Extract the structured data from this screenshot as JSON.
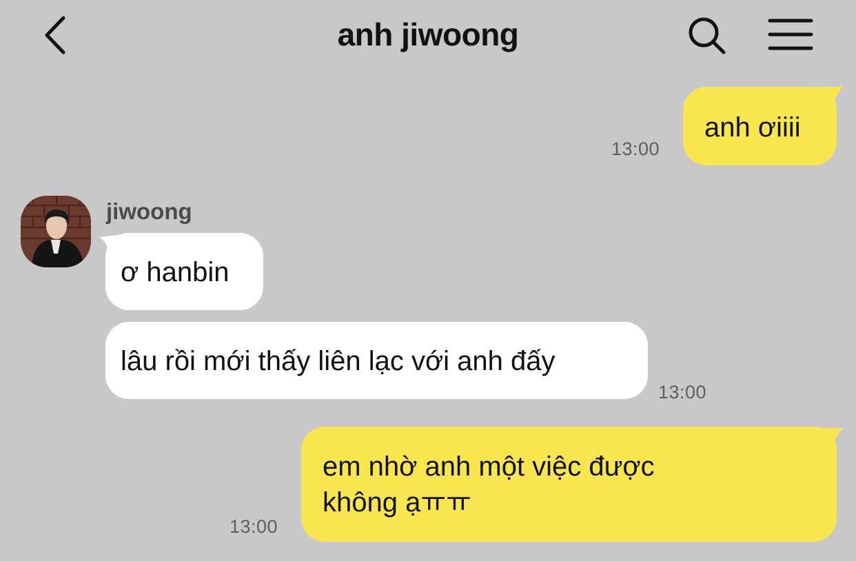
{
  "header": {
    "title": "anh jiwoong",
    "back_icon": "chevron-left-icon",
    "search_icon": "search-icon",
    "menu_icon": "hamburger-menu-icon"
  },
  "colors": {
    "background": "#c8c8c8",
    "my_bubble": "#f9e64f",
    "their_bubble": "#ffffff",
    "timestamp": "#5e5e5e"
  },
  "contact": {
    "name": "jiwoong"
  },
  "messages": [
    {
      "sender": "me",
      "text": "anh ơiiii",
      "time": "13:00"
    },
    {
      "sender": "jiwoong",
      "text": "ơ hanbin"
    },
    {
      "sender": "jiwoong",
      "text": "lâu rồi mới thấy liên lạc với anh đấy",
      "time": "13:00"
    },
    {
      "sender": "me",
      "lines": [
        "em nhờ anh một việc được",
        "không ạㅠㅠ"
      ],
      "time": "13:00"
    }
  ]
}
